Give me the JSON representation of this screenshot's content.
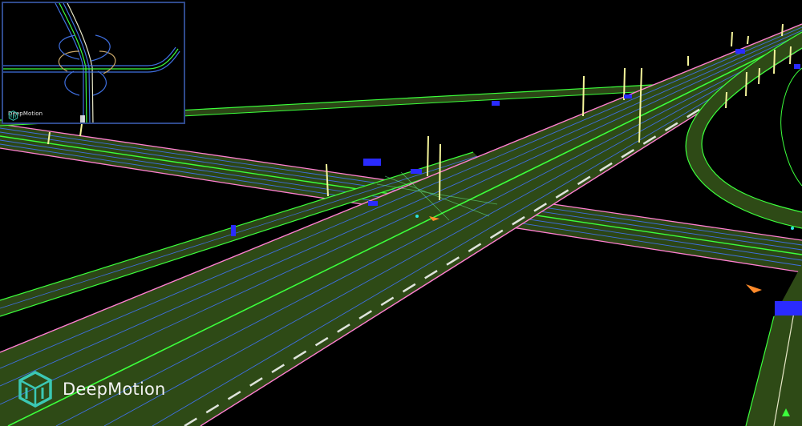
{
  "brand": {
    "name": "DeepMotion",
    "logo_icon": "deepmotion-cube-logo",
    "accent": "#3bc8b4"
  },
  "minimap": {
    "brand_name": "DeepMotion",
    "border_color": "#2f4a8c"
  },
  "scene": {
    "road_fill": "#2e4a16",
    "road_edge_color": "#ff7fd1",
    "lane_line_color": "#3f6fe0",
    "center_line_color": "#3cff3c",
    "pole_color": "#f5f59a",
    "sign_color": "#2a2bff"
  }
}
